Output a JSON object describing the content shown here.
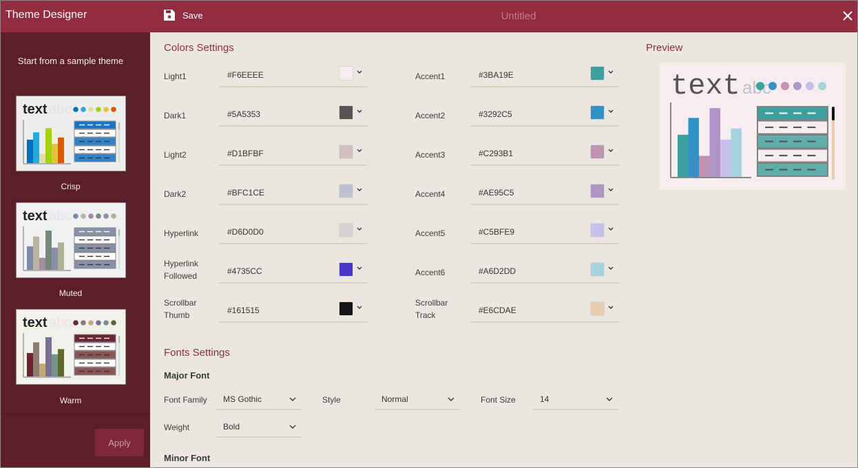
{
  "titlebar": {
    "app_title": "Theme Designer",
    "save_label": "Save",
    "document_title": "Untitled",
    "icons": {
      "save": "save-icon",
      "close": "close-icon"
    }
  },
  "sidebar": {
    "heading": "Start from a sample theme",
    "themes": [
      {
        "name": "Crisp",
        "background": "#EEEEEE",
        "text_color": "#222222",
        "abc_color": "#E2E2E2",
        "accents": [
          "#0070C0",
          "#27A9DB",
          "#E2DCAA",
          "#A2D200",
          "#E2C43A",
          "#DA5800"
        ],
        "table_header": "#1B73C8",
        "table_alt": "#2D83CC",
        "bar_values": [
          0.55,
          0.72,
          0.22,
          0.82,
          0.45,
          0.6
        ]
      },
      {
        "name": "Muted",
        "background": "#F0F1F3",
        "text_color": "#222222",
        "abc_color": "#E4E6EA",
        "accents": [
          "#7E88A8",
          "#BAB5A0",
          "#A68AA4",
          "#76887C",
          "#8A8FAA",
          "#ACB294"
        ],
        "table_header": "#8891AA",
        "table_alt": "#8891AA",
        "bar_values": [
          0.55,
          0.78,
          0.28,
          0.92,
          0.52,
          0.64
        ]
      },
      {
        "name": "Warm",
        "background": "#F3F1EE",
        "text_color": "#222222",
        "abc_color": "#E8E4E0",
        "accents": [
          "#6B2530",
          "#8D7A72",
          "#C2AA78",
          "#7A7090",
          "#78938E",
          "#5E6A2C"
        ],
        "table_header": "#6B2530",
        "table_alt": "#8C5558",
        "bar_values": [
          0.55,
          0.8,
          0.3,
          0.92,
          0.52,
          0.64
        ]
      }
    ],
    "apply_label": "Apply"
  },
  "colors_settings": {
    "title": "Colors Settings",
    "left": [
      {
        "label": "Light1",
        "value": "#F6EEEE"
      },
      {
        "label": "Dark1",
        "value": "#5A5353"
      },
      {
        "label": "Light2",
        "value": "#D1BFBF"
      },
      {
        "label": "Dark2",
        "value": "#BFC1CE"
      },
      {
        "label": "Hyperlink",
        "value": "#D6D0D0"
      },
      {
        "label": "Hyperlink\nFollowed",
        "value": "#4735CC"
      },
      {
        "label": "Scrollbar\nThumb",
        "value": "#161515"
      }
    ],
    "right": [
      {
        "label": "Accent1",
        "value": "#3BA19E"
      },
      {
        "label": "Accent2",
        "value": "#3292C5"
      },
      {
        "label": "Accent3",
        "value": "#C293B1"
      },
      {
        "label": "Accent4",
        "value": "#AE95C5"
      },
      {
        "label": "Accent5",
        "value": "#C5BFE9"
      },
      {
        "label": "Accent6",
        "value": "#A6D2DD"
      },
      {
        "label": "Scrollbar\nTrack",
        "value": "#E6CDAE"
      }
    ]
  },
  "fonts_settings": {
    "title": "Fonts Settings",
    "major_font": {
      "title": "Major Font",
      "font_family_label": "Font Family",
      "font_family": "MS Gothic",
      "style_label": "Style",
      "style": "Normal",
      "font_size_label": "Font Size",
      "font_size": "14",
      "weight_label": "Weight",
      "weight": "Bold"
    },
    "minor_font": {
      "title": "Minor Font"
    }
  },
  "preview": {
    "title": "Preview",
    "sample_text": "text",
    "sample_abc": "abc",
    "bar_values": [
      0.6,
      0.84,
      0.3,
      0.98,
      0.53,
      0.69
    ]
  }
}
